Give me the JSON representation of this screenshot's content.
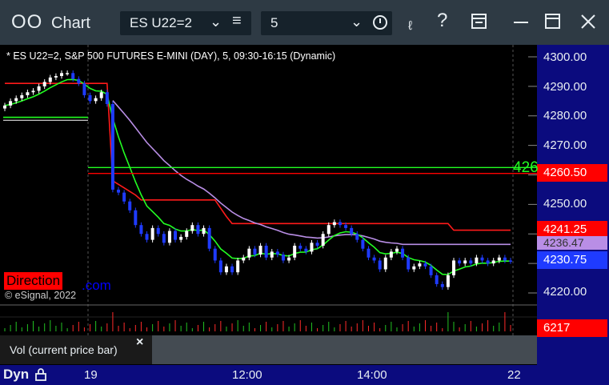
{
  "window": {
    "title": "Chart",
    "icon": "chart-window-icon"
  },
  "toolbar": {
    "symbol": "ES U22=2",
    "interval": "5",
    "icons": [
      "link-icon",
      "help-icon",
      "layout-icon",
      "restore-icon",
      "close-icon"
    ]
  },
  "info_line": "* ES U22=2, S&P 500 FUTURES E-MINI (DAY), 5, 09:30-16:15 (Dynamic)",
  "copyright": "© eSignal, 2022",
  "direction_label": "Direction",
  "direction_suffix": ".com",
  "volume_panel": {
    "label": "Vol (current price bar)",
    "close": "×",
    "last_value": "6217"
  },
  "footer": {
    "mode": "Dyn",
    "time_ticks": [
      "19",
      "12:00",
      "14:00",
      "22"
    ]
  },
  "price_badges": {
    "green_line_edge": "426",
    "red_line": "4260.50",
    "red_band": "4241.25",
    "purple_band": "4236.47",
    "last_price": "4230.75"
  },
  "colors": {
    "red": "#ff0000",
    "green": "#22ff22",
    "purple": "#b98ee6",
    "blue": "#1f3bff",
    "white": "#ffffff",
    "axis": "#0b0b7e"
  },
  "chart_data": {
    "type": "candlestick",
    "symbol": "ES U22=2",
    "y_ticks": [
      4300,
      4290,
      4280,
      4270,
      4260,
      4250,
      4240,
      4230,
      4220
    ],
    "y_tick_labels": [
      "4300.00",
      "4290.00",
      "4280.00",
      "4270.00",
      "4250.00",
      "4220.00"
    ],
    "ylim": [
      4216.5,
      4304
    ],
    "x_ticks": [
      "19",
      "12:00",
      "14:00",
      "22"
    ],
    "horizontal_levels": [
      {
        "color": "#22ff22",
        "value": 4262.5
      },
      {
        "color": "#ff0000",
        "value": 4260.5
      }
    ],
    "closes": [
      4283.5,
      4285,
      4286,
      4287,
      4288,
      4288.5,
      4290,
      4291.5,
      4293,
      4293.5,
      4294.5,
      4294.5,
      4292.5,
      4291,
      4287,
      4285,
      4286,
      4288,
      4284,
      4255,
      4254,
      4251,
      4248,
      4243,
      4240,
      4238,
      4242,
      4240,
      4237,
      4241,
      4238,
      4239,
      4241,
      4243,
      4240,
      4242,
      4235,
      4231,
      4227,
      4229,
      4227,
      4231,
      4232,
      4235,
      4233,
      4236,
      4232,
      4234,
      4233,
      4231,
      4232,
      4236,
      4235,
      4234,
      4237,
      4236,
      4240,
      4243,
      4244,
      4243,
      4242,
      4240,
      4238,
      4235,
      4232,
      4231,
      4228,
      4232,
      4234,
      4235,
      4232,
      4228,
      4229,
      4230,
      4229,
      4226,
      4223,
      4222,
      4226,
      4231,
      4230,
      4231,
      4230,
      4232,
      4231,
      4230,
      4231,
      4232,
      4231,
      4230.75
    ],
    "bands": {
      "red_upper_start": 4291,
      "red_upper_end": 4241.25,
      "purple_end": 4236.47,
      "green_end": 4229
    },
    "volume": {
      "last": 6217
    }
  }
}
